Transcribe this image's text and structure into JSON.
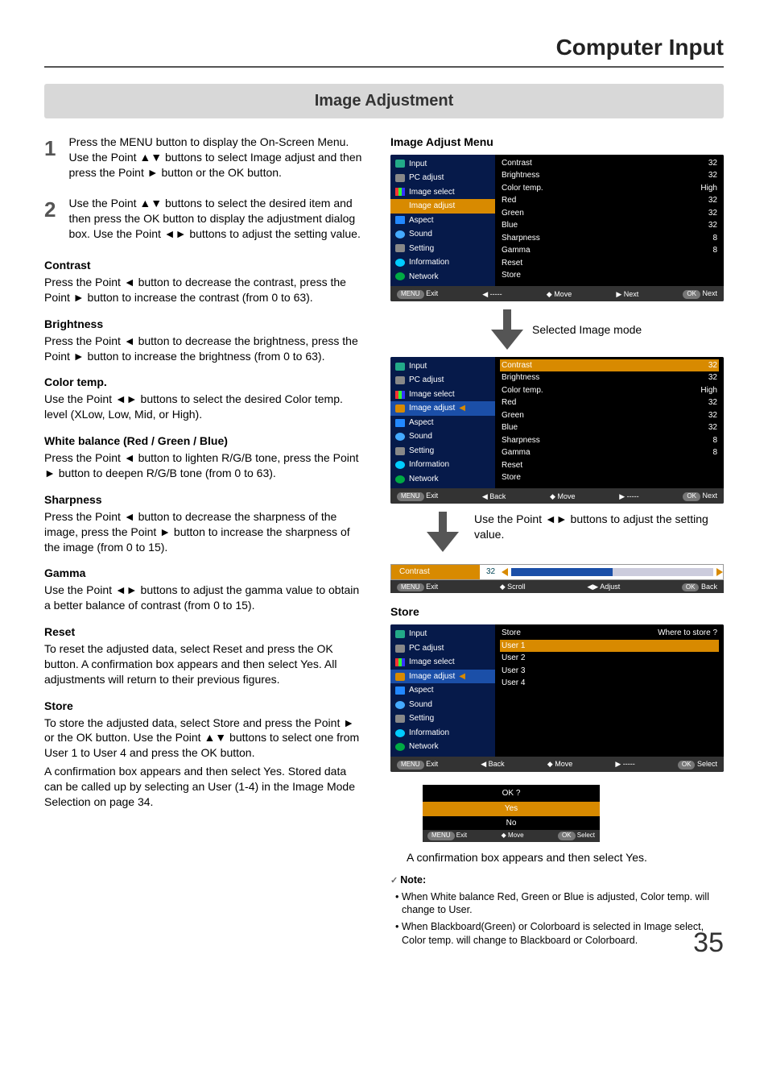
{
  "page": {
    "header": "Computer Input",
    "section": "Image Adjustment",
    "number": "35"
  },
  "steps": {
    "s1_num": "1",
    "s1": "Press the MENU button to display the On-Screen Menu.  Use the Point ▲▼ buttons to select Image adjust and then press the Point ► button or the OK button.",
    "s2_num": "2",
    "s2": "Use the Point ▲▼ buttons to select the desired item and then press the OK button to display the adjustment dialog box.  Use the Point ◄► buttons to adjust the setting value."
  },
  "sub": {
    "contrast_h": "Contrast",
    "contrast": "Press the Point ◄ button to decrease the contrast, press the Point ► button to increase the contrast (from 0 to 63).",
    "brightness_h": "Brightness",
    "brightness": "Press the Point ◄ button to decrease the brightness, press  the Point ► button to increase the brightness (from 0 to 63).",
    "colortemp_h": "Color temp.",
    "colortemp": "Use the Point ◄► buttons to select the desired Color temp. level (XLow, Low, Mid, or High).",
    "wb_h": "White balance (Red / Green / Blue)",
    "wb": "Press the Point ◄ button to lighten R/G/B tone, press the Point ► button to deepen R/G/B tone (from 0 to 63).",
    "sharp_h": "Sharpness",
    "sharp": "Press the Point ◄ button to decrease the sharpness of the image, press the Point ► button to increase the sharpness of the image (from 0 to 15).",
    "gamma_h": "Gamma",
    "gamma": "Use the Point ◄► buttons to adjust the gamma value to obtain a better balance of contrast (from 0 to 15).",
    "reset_h": "Reset",
    "reset": "To reset the adjusted data, select Reset and press the OK button. A confirmation box appears and then select Yes. All adjustments will return to their previous figures.",
    "store_h": "Store",
    "store": "To store the adjusted data, select Store and press the Point ► or the OK button. Use the Point ▲▼ buttons to select one from User 1 to User 4 and press the OK button.",
    "store2": "A confirmation box appears and then select Yes. Stored data can be called up by selecting an User (1-4) in the Image Mode Selection on page 34."
  },
  "right": {
    "osd1_title": "Image Adjust Menu",
    "selected_label": "Selected Image mode",
    "pointer_note": "Use the Point ◄► buttons to adjust the setting value.",
    "store_title": "Store",
    "confirm_note": "A confirmation box appears and then select Yes."
  },
  "osd_side": {
    "input": "Input",
    "pcadjust": "PC adjust",
    "imgselect": "Image select",
    "imgadjust": "Image adjust",
    "aspect": "Aspect",
    "sound": "Sound",
    "setting": "Setting",
    "info": "Information",
    "network": "Network"
  },
  "osd_params": {
    "contrast": "Contrast",
    "brightness": "Brightness",
    "colortemp": "Color temp.",
    "red": "Red",
    "green": "Green",
    "blue": "Blue",
    "sharpness": "Sharpness",
    "gamma": "Gamma",
    "reset": "Reset",
    "store": "Store",
    "v32": "32",
    "vhigh": "High",
    "v8": "8"
  },
  "osd_store": {
    "store": "Store",
    "u1": "User 1",
    "u2": "User 2",
    "u3": "User 3",
    "u4": "User 4",
    "where": "Where to store ?"
  },
  "footer": {
    "exit": "Exit",
    "move": "Move",
    "next": "Next",
    "oknext": "Next",
    "back": "Back",
    "select": "Select",
    "scroll": "Scroll",
    "adjust": "Adjust",
    "dashes": "-----",
    "menu": "MENU",
    "ok": "OK",
    "ud": "◆"
  },
  "slider": {
    "label": "Contrast",
    "value": "32"
  },
  "confirm": {
    "ok": "OK ?",
    "yes": "Yes",
    "no": "No"
  },
  "notes": {
    "head": "Note:",
    "n1": "When White balance Red, Green or Blue is adjusted, Color temp. will change to User.",
    "n2": "When Blackboard(Green) or Colorboard is selected in Image select, Color temp. will change to Blackboard or Colorboard."
  }
}
